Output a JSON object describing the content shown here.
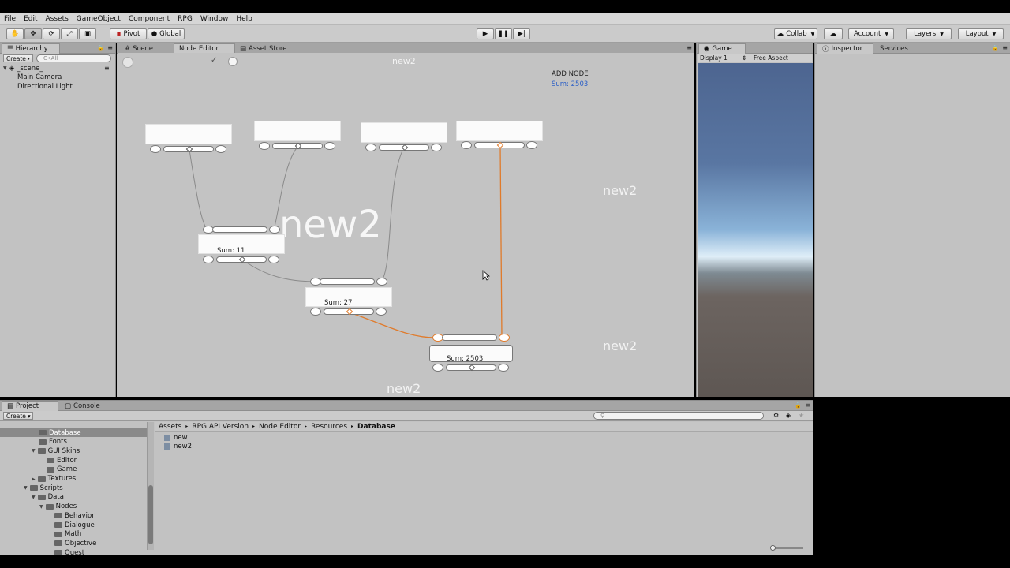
{
  "menu": [
    "File",
    "Edit",
    "Assets",
    "GameObject",
    "Component",
    "RPG",
    "Window",
    "Help"
  ],
  "toolbar": {
    "pivot_label": "Pivot",
    "global_label": "Global",
    "collab_label": "Collab",
    "account_label": "Account",
    "layers_label": "Layers",
    "layout_label": "Layout"
  },
  "hierarchy": {
    "tab_label": "Hierarchy",
    "create_label": "Create",
    "search_placeholder": "G•All",
    "scene_name": "_scene_",
    "items": [
      "Main Camera",
      "Directional Light"
    ]
  },
  "center_tabs": [
    "Scene",
    "Node Editor",
    "Asset Store"
  ],
  "node_editor": {
    "title": "new2",
    "big_watermark": "new2",
    "add_node_label": "ADD NODE",
    "sum_label": "Sum: 2503",
    "watermarks": [
      "new2",
      "new2",
      "new2"
    ],
    "node_sums": [
      "Sum: 11",
      "Sum: 27",
      "Sum: 2503"
    ],
    "accent_color": "#e07a2a",
    "wire_color": "#8a8a8a"
  },
  "game": {
    "tab_label": "Game",
    "display_label": "Display 1",
    "aspect_label": "Free Aspect"
  },
  "inspector": {
    "tab_label": "Inspector",
    "services_label": "Services"
  },
  "project": {
    "tab_label": "Project",
    "console_label": "Console",
    "create_label": "Create",
    "breadcrumb": [
      "Assets",
      "RPG API Version",
      "Node Editor",
      "Resources",
      "Database"
    ],
    "tree": [
      {
        "label": "Database",
        "indent": 3,
        "selected": true
      },
      {
        "label": "Fonts",
        "indent": 3
      },
      {
        "label": "GUI Skins",
        "indent": 3,
        "open": true
      },
      {
        "label": "Editor",
        "indent": 4
      },
      {
        "label": "Game",
        "indent": 4
      },
      {
        "label": "Textures",
        "indent": 3,
        "closed": true
      },
      {
        "label": "Scripts",
        "indent": 2,
        "open": true
      },
      {
        "label": "Data",
        "indent": 3,
        "open": true
      },
      {
        "label": "Nodes",
        "indent": 4,
        "open": true
      },
      {
        "label": "Behavior",
        "indent": 5
      },
      {
        "label": "Dialogue",
        "indent": 5
      },
      {
        "label": "Math",
        "indent": 5
      },
      {
        "label": "Objective",
        "indent": 5
      },
      {
        "label": "Quest",
        "indent": 5
      }
    ],
    "files": [
      "new",
      "new2"
    ]
  }
}
